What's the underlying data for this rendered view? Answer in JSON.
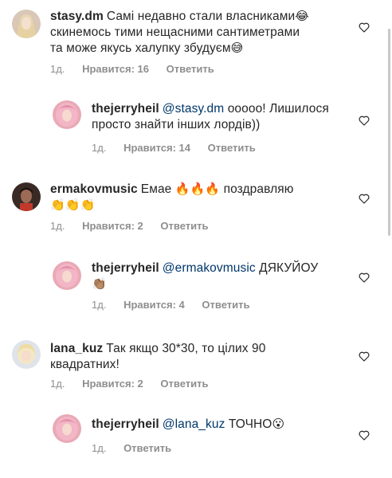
{
  "comments": [
    {
      "username": "stasy.dm",
      "text": "Самі недавно стали власниками",
      "emoji1": "😂",
      "line2": "скинемось тими нещасними сантиметрами",
      "line3": "та може якусь халупку збудуєм",
      "emoji2": "😅",
      "time": "1д.",
      "likes": "Нравится: 16",
      "reply": "Ответить"
    },
    {
      "username": "thejerryheil",
      "mention": "@stasy.dm",
      "text": "ооооо! Лишилося",
      "line2": "просто знайти інших лордів))",
      "time": "1д.",
      "likes": "Нравится: 14",
      "reply": "Ответить"
    },
    {
      "username": "ermakovmusic",
      "text": "Емае",
      "emojis": "🔥🔥🔥",
      "text2": "поздравляю",
      "line2": "👏👏👏",
      "time": "1д.",
      "likes": "Нравится: 2",
      "reply": "Ответить"
    },
    {
      "username": "thejerryheil",
      "mention": "@ermakovmusic",
      "text": "ДЯКУЙОУ",
      "line2": "👏🏽",
      "time": "1д.",
      "likes": "Нравится: 4",
      "reply": "Ответить"
    },
    {
      "username": "lana_kuz",
      "text": "Так якщо 30*30, то цілих 90",
      "line2": "квадратних!",
      "time": "1д.",
      "likes": "Нравится: 2",
      "reply": "Ответить"
    },
    {
      "username": "thejerryheil",
      "mention": "@lana_kuz",
      "text": "ТОЧНО",
      "emoji": "😮",
      "time": "1д.",
      "reply": "Ответить"
    }
  ],
  "icons": {
    "heart": "heart-outline-icon"
  },
  "colors": {
    "text": "#262626",
    "secondary": "#8e8e8e",
    "mention": "#00376b"
  }
}
